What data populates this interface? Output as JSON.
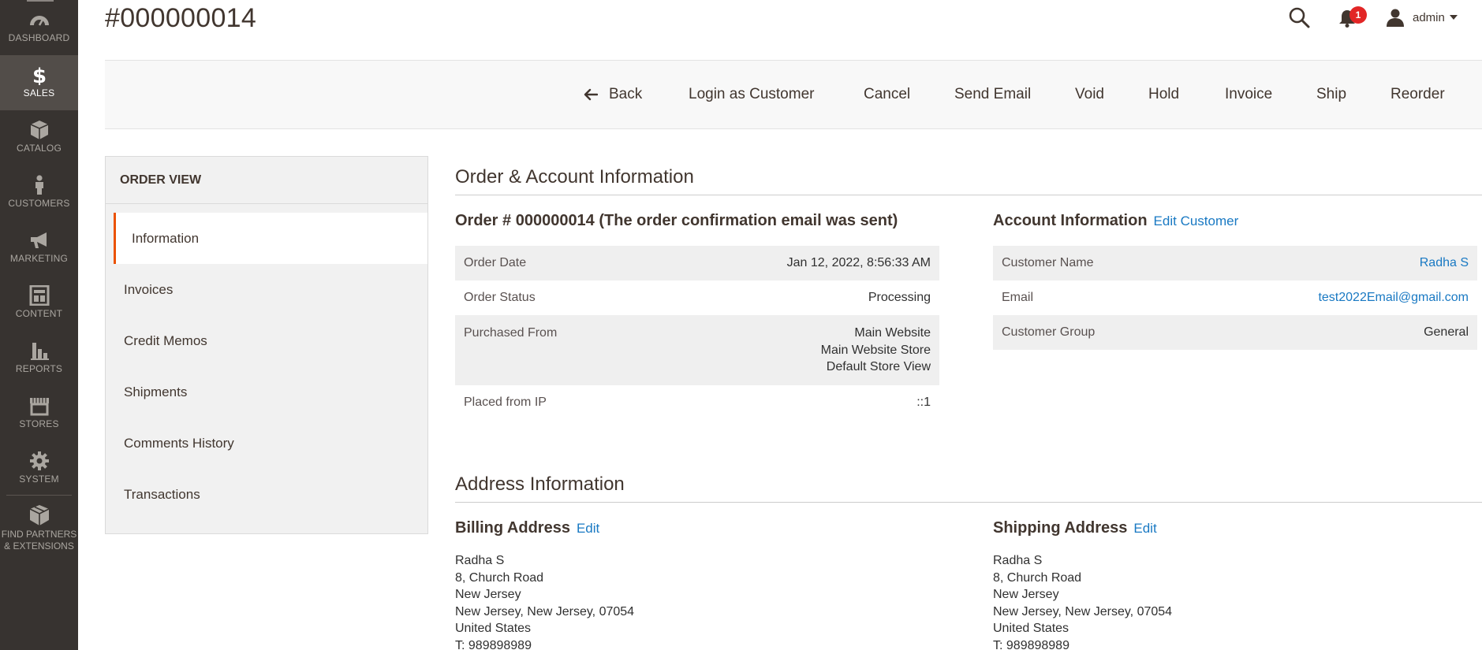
{
  "sidebar": {
    "items": [
      {
        "label": "Dashboard",
        "icon": "dashboard-icon"
      },
      {
        "label": "Sales",
        "icon": "dollar-icon"
      },
      {
        "label": "Catalog",
        "icon": "cube-icon"
      },
      {
        "label": "Customers",
        "icon": "person-icon"
      },
      {
        "label": "Marketing",
        "icon": "megaphone-icon"
      },
      {
        "label": "Content",
        "icon": "layout-icon"
      },
      {
        "label": "Reports",
        "icon": "bar-chart-icon"
      },
      {
        "label": "Stores",
        "icon": "storefront-icon"
      },
      {
        "label": "System",
        "icon": "gear-icon"
      }
    ],
    "partners_line1": "Find Partners",
    "partners_line2": "& Extensions",
    "active": "Sales"
  },
  "header": {
    "title": "#000000014",
    "notification_count": "1",
    "user": "admin"
  },
  "toolbar": {
    "back": "Back",
    "login_as_customer": "Login as Customer",
    "cancel": "Cancel",
    "send_email": "Send Email",
    "void": "Void",
    "hold": "Hold",
    "invoice": "Invoice",
    "ship": "Ship",
    "reorder": "Reorder"
  },
  "order_view": {
    "title": "Order View",
    "tabs": [
      "Information",
      "Invoices",
      "Credit Memos",
      "Shipments",
      "Comments History",
      "Transactions"
    ]
  },
  "order_account": {
    "section_title": "Order & Account Information",
    "order_heading": "Order # 000000014 (The order confirmation email was sent)",
    "order_rows": {
      "order_date_label": "Order Date",
      "order_date": "Jan 12, 2022, 8:56:33 AM",
      "status_label": "Order Status",
      "status": "Processing",
      "purchased_from_label": "Purchased From",
      "purchased_from": [
        "Main Website",
        "Main Website Store",
        "Default Store View"
      ],
      "ip_label": "Placed from IP",
      "ip": "::1"
    },
    "account_heading": "Account Information",
    "edit_customer": "Edit Customer",
    "account_rows": {
      "name_label": "Customer Name",
      "name": "Radha S",
      "email_label": "Email",
      "email": "test2022Email@gmail.com",
      "group_label": "Customer Group",
      "group": "General"
    }
  },
  "address": {
    "section_title": "Address Information",
    "billing": {
      "heading": "Billing Address",
      "edit": "Edit",
      "lines": [
        "Radha S",
        "8, Church Road",
        "New Jersey",
        "New Jersey, New Jersey, 07054",
        "United States",
        "T: 989898989"
      ]
    },
    "shipping": {
      "heading": "Shipping Address",
      "edit": "Edit",
      "lines": [
        "Radha S",
        "8, Church Road",
        "New Jersey",
        "New Jersey, New Jersey, 07054",
        "United States",
        "T: 989898989"
      ]
    }
  },
  "colors": {
    "sidebar_bg": "#373330",
    "sidebar_active": "#524d49",
    "accent": "#eb5202",
    "link": "#1979c3",
    "badge": "#e22626"
  }
}
